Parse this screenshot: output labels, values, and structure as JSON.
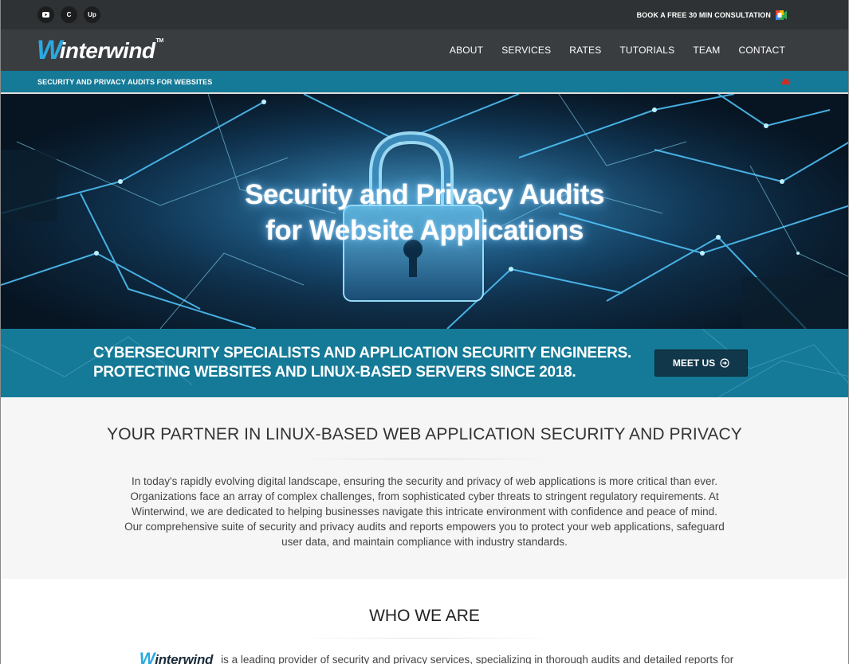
{
  "topbar": {
    "social": [
      {
        "name": "youtube-icon",
        "glyph": "▶"
      },
      {
        "name": "codementor-icon",
        "glyph": "C"
      },
      {
        "name": "upwork-icon",
        "glyph": "Up"
      }
    ],
    "consult_label": "BOOK A FREE 30 MIN CONSULTATION"
  },
  "navbar": {
    "logo_w": "W",
    "logo_rest": "interwind",
    "logo_tm": "TM",
    "items": [
      "ABOUT",
      "SERVICES",
      "RATES",
      "TUTORIALS",
      "TEAM",
      "CONTACT"
    ]
  },
  "tagline": {
    "text": "SECURITY AND PRIVACY AUDITS FOR WEBSITES"
  },
  "hero": {
    "title_line1": "Security and Privacy Audits",
    "title_line2": "for Website Applications"
  },
  "callout": {
    "line1": "CYBERSECURITY SPECIALISTS AND APPLICATION SECURITY ENGINEERS.",
    "line2": "PROTECTING WEBSITES AND LINUX-BASED SERVERS SINCE 2018.",
    "button_label": "MEET US"
  },
  "partner": {
    "heading": "YOUR PARTNER IN LINUX-BASED WEB APPLICATION SECURITY AND PRIVACY",
    "body": "In today's rapidly evolving digital landscape, ensuring the security and privacy of web applications is more critical than ever. Organizations face an array of complex challenges, from sophisticated cyber threats to stringent regulatory requirements. At Winterwind, we are dedicated to helping businesses navigate this intricate environment with confidence and peace of mind. Our comprehensive suite of security and privacy audits and reports empowers you to protect your web applications, safeguard user data, and maintain compliance with industry standards."
  },
  "who": {
    "heading": "WHO WE ARE",
    "logo_w": "W",
    "logo_rest": "interwind",
    "text": "is a leading provider of security and privacy services, specializing in thorough audits and detailed reports for"
  },
  "colors": {
    "topbar_bg": "#2f3234",
    "nav_bg": "#3a3d40",
    "accent_teal": "#157a97",
    "logo_blue": "#29a9e1",
    "button_dark": "#11374a",
    "flag_red": "#d52b1e"
  }
}
